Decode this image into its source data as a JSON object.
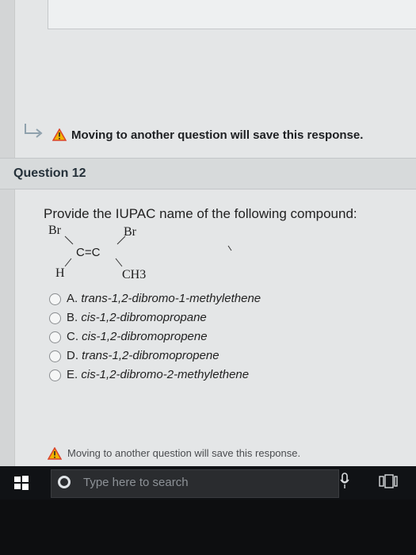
{
  "warning": {
    "top_text": "Moving to another question will save this response.",
    "bottom_text": "Moving to another question will save this response."
  },
  "question": {
    "title": "Question 12",
    "prompt": "Provide the IUPAC name of the following compound:",
    "structure": {
      "top_left": "Br",
      "top_right": "Br",
      "center": "C=C",
      "bottom_left": "H",
      "bottom_right": "CH3"
    },
    "options": [
      {
        "letter": "A.",
        "text": "trans-1,2-dibromo-1-methylethene",
        "selected": false
      },
      {
        "letter": "B.",
        "text": "cis-1,2-dibromopropane",
        "selected": false
      },
      {
        "letter": "C.",
        "text": "cis-1,2-dibromopropene",
        "selected": false
      },
      {
        "letter": "D.",
        "text": "trans-1,2-dibromopropene",
        "selected": false
      },
      {
        "letter": "E.",
        "text": "cis-1,2-dibromo-2-methylethene",
        "selected": false
      }
    ]
  },
  "taskbar": {
    "search_placeholder": "Type here to search",
    "icons": [
      "windows-start-icon",
      "cortana-icon",
      "microphone-icon",
      "task-view-icon"
    ]
  },
  "colors": {
    "warning_yellow": "#f2b400",
    "warning_red": "#d9432c",
    "page_bg": "#e4e6e7",
    "taskbar_bg": "#101215"
  }
}
